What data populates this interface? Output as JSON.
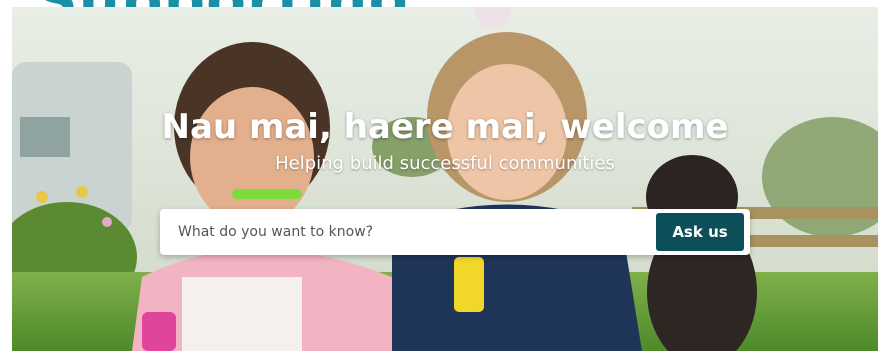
{
  "page": {
    "top_heading": "Supporting"
  },
  "hero": {
    "title": "Nau mai, haere mai, welcome",
    "subtitle": "Helping build successful communities"
  },
  "search": {
    "placeholder": "What do you want to know?",
    "button_label": "Ask us"
  },
  "colors": {
    "heading": "#1b8fa6",
    "button": "#0d4f59"
  }
}
